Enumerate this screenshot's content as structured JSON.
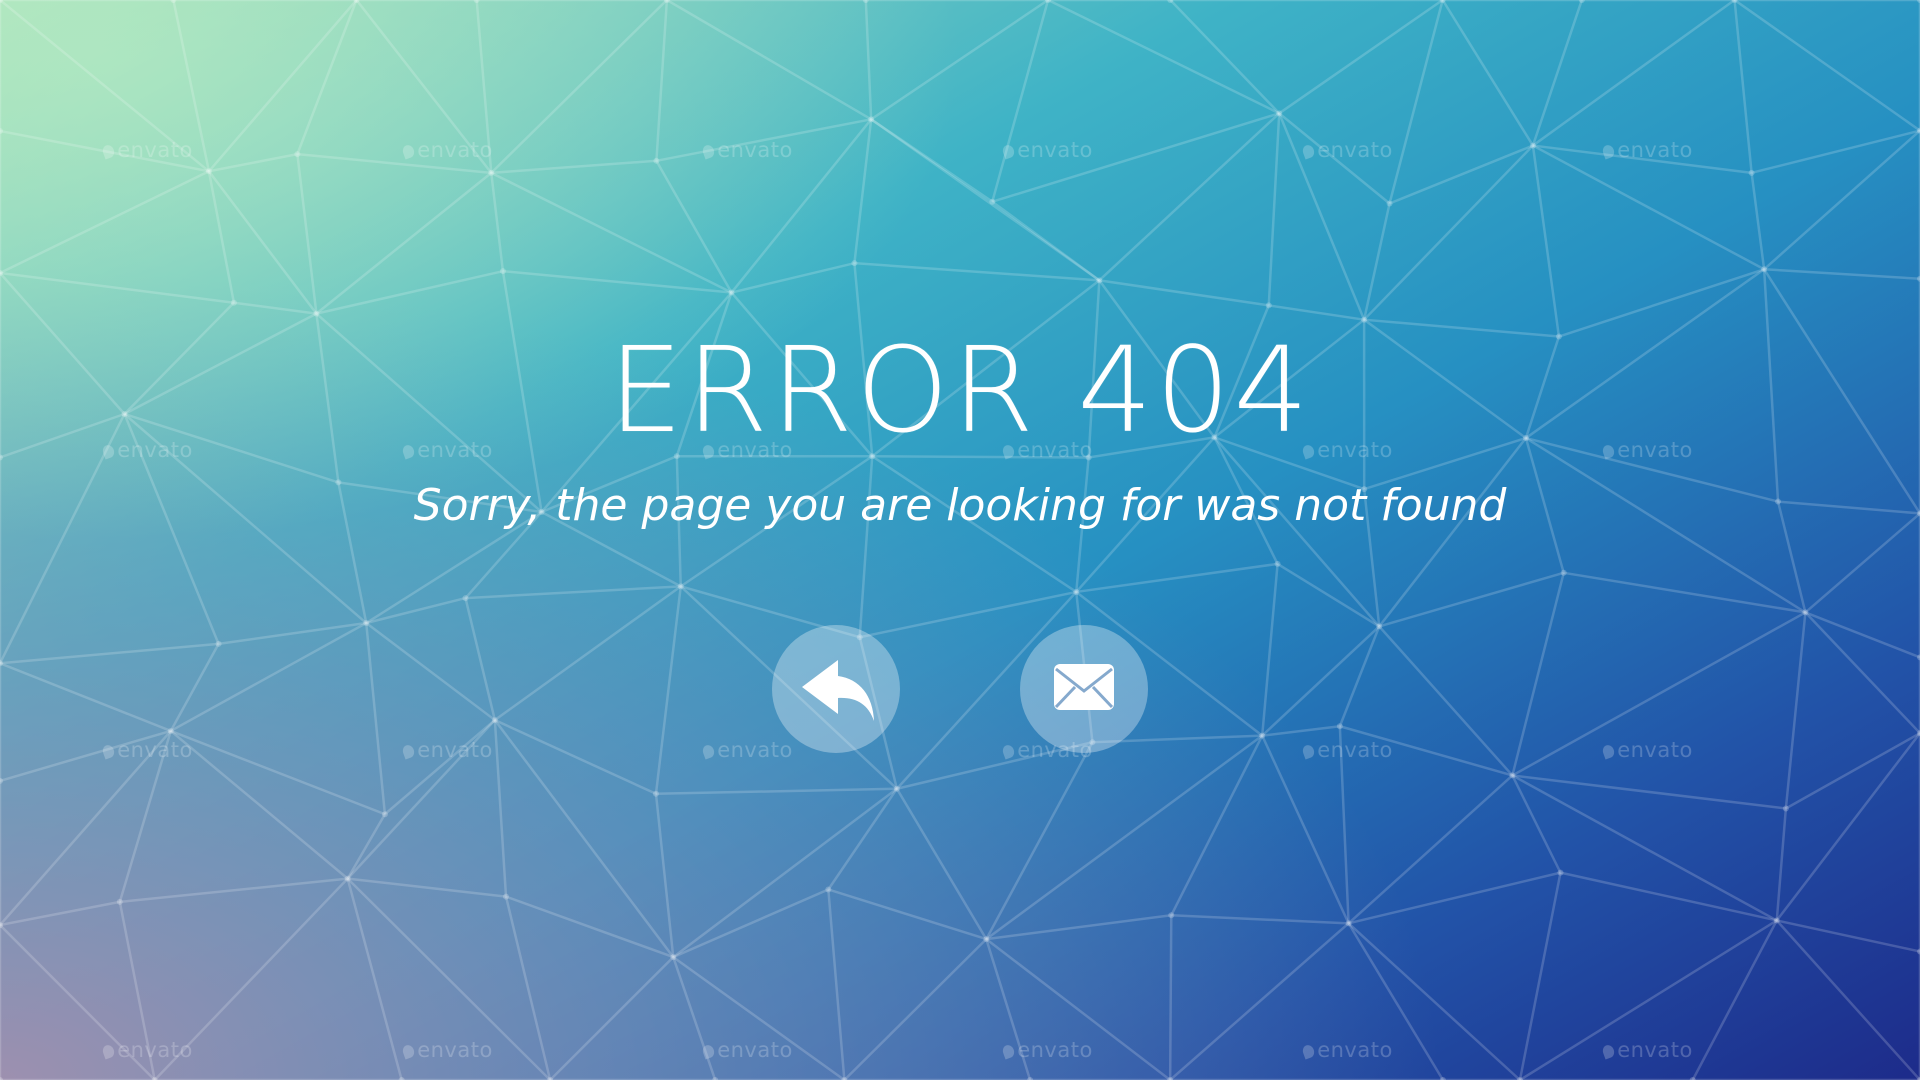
{
  "error": {
    "title": "ERROR 404",
    "message": "Sorry, the page you are looking for was not found"
  },
  "actions": [
    {
      "name": "back",
      "icon": "reply-arrow-icon"
    },
    {
      "name": "contact",
      "icon": "envelope-icon"
    }
  ],
  "watermark": {
    "text": "envato"
  },
  "colors": {
    "gradient_top_left": "#9fdcc0",
    "gradient_center": "#2a96c4",
    "gradient_bottom_right": "#1f2e8c",
    "gradient_bottom_left": "#9a8aa8",
    "text": "#ffffff",
    "button_fill": "rgba(255,255,255,0.32)"
  }
}
